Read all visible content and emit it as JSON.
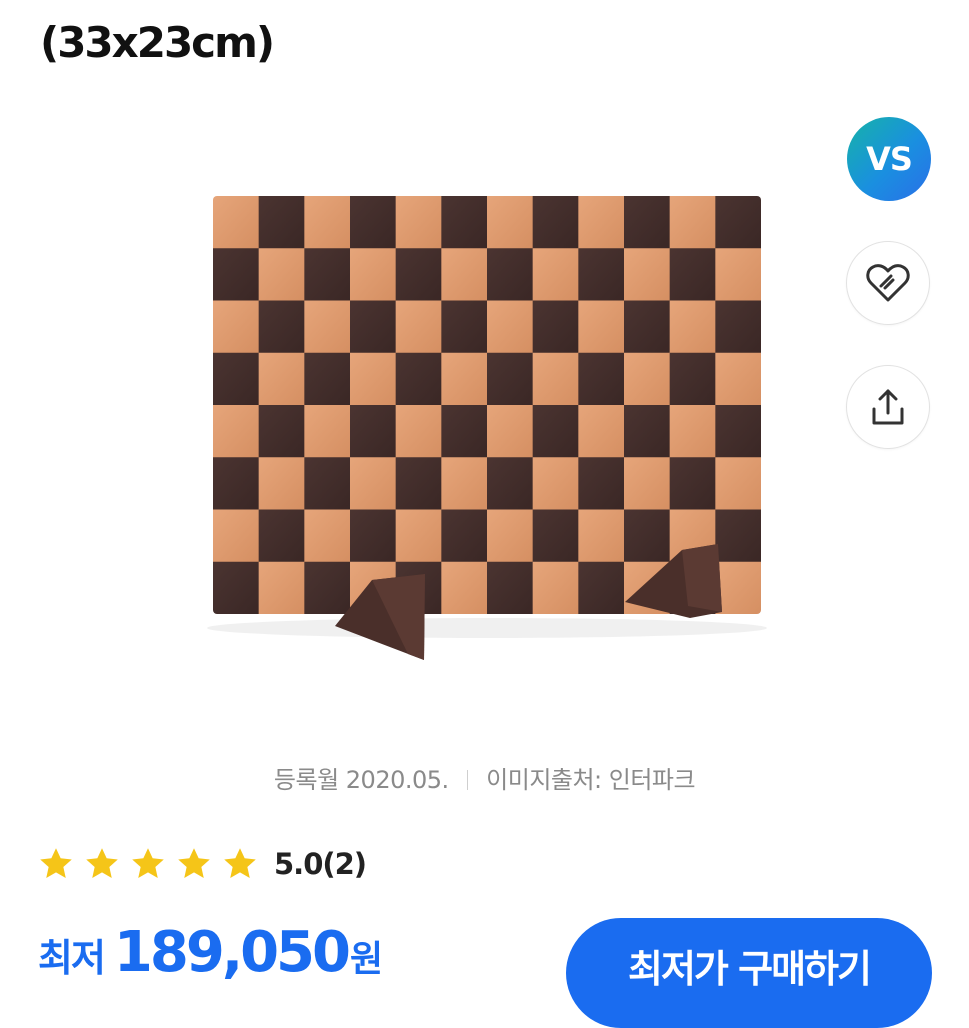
{
  "product": {
    "title": "(33x23cm)"
  },
  "actions": {
    "vs_label": "VS",
    "zzim_icon": "heart-link-icon",
    "share_icon": "share-icon"
  },
  "meta": {
    "registered": "등록월 2020.05.",
    "image_source": "이미지출처: 인터파크"
  },
  "rating": {
    "stars": 5,
    "score": "5.0",
    "count": "(2)",
    "star_color": "#f5c518"
  },
  "price": {
    "label": "최저",
    "value": "189,050",
    "unit": "원",
    "accent": "#1a6cf0"
  },
  "buy_button": {
    "label": "최저가 구매하기"
  }
}
